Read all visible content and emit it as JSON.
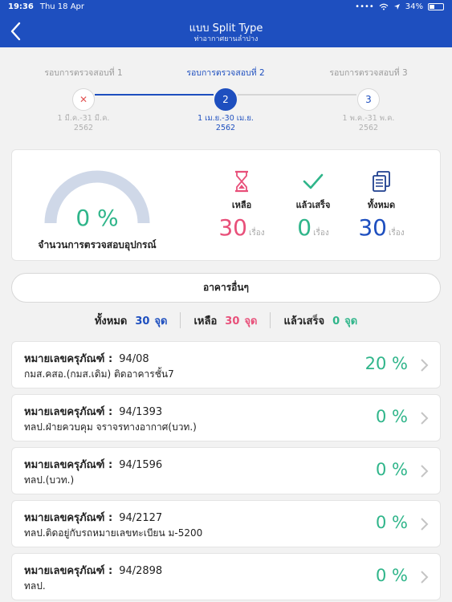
{
  "status_bar": {
    "time": "19:36",
    "date": "Thu 18 Apr",
    "battery": "34%"
  },
  "header": {
    "title": "แบบ Split Type",
    "subtitle": "ท่าอากาศยานลำปาง"
  },
  "steps": [
    {
      "label": "รอบการตรวจสอบที่ 1",
      "marker": "✕",
      "date1": "1 มี.ค.-31 มี.ค.",
      "date2": "2562"
    },
    {
      "label": "รอบการตรวจสอบที่ 2",
      "marker": "2",
      "date1": "1 เม.ย.-30 เม.ย.",
      "date2": "2562"
    },
    {
      "label": "รอบการตรวจสอบที่ 3",
      "marker": "3",
      "date1": "1 พ.ค.-31 พ.ค.",
      "date2": "2562"
    }
  ],
  "summary": {
    "gauge_value": "0 %",
    "gauge_label": "จำนวนการตรวจสอบอุปกรณ์",
    "stats": [
      {
        "name": "เหลือ",
        "value": "30",
        "unit": "เรื่อง",
        "color": "#e8507a",
        "icon": "hourglass-icon"
      },
      {
        "name": "แล้วเสร็จ",
        "value": "0",
        "unit": "เรื่อง",
        "color": "#2fb58a",
        "icon": "check-icon"
      },
      {
        "name": "ทั้งหมด",
        "value": "30",
        "unit": "เรื่อง",
        "color": "#1e4fbf",
        "icon": "documents-icon"
      }
    ]
  },
  "building": {
    "label": "อาคารอื่นๆ"
  },
  "counts": [
    {
      "label": "ทั้งหมด",
      "value": "30",
      "unit": "จุด",
      "color": "#1e4fbf"
    },
    {
      "label": "เหลือ",
      "value": "30",
      "unit": "จุด",
      "color": "#e8507a"
    },
    {
      "label": "แล้วเสร็จ",
      "value": "0",
      "unit": "จุด",
      "color": "#2fb58a"
    }
  ],
  "devices": [
    {
      "key": "หมายเลขครุภัณฑ์ :",
      "id": "94/08",
      "desc": "กมส.คสอ.(กมส.เดิม) ติดอาคารชั้น7",
      "percent": "20 %"
    },
    {
      "key": "หมายเลขครุภัณฑ์ :",
      "id": "94/1393",
      "desc": "ทลป.ฝ่ายควบคุม จราจรทางอากาศ(บวท.)",
      "percent": "0 %"
    },
    {
      "key": "หมายเลขครุภัณฑ์ :",
      "id": "94/1596",
      "desc": "ทลป.(บวท.)",
      "percent": "0 %"
    },
    {
      "key": "หมายเลขครุภัณฑ์ :",
      "id": "94/2127",
      "desc": "ทลป.ติดอยู่กับรถหมายเลขทะเบียน ม-5200",
      "percent": "0 %"
    },
    {
      "key": "หมายเลขครุภัณฑ์ :",
      "id": "94/2898",
      "desc": "ทลป.",
      "percent": "0 %"
    }
  ]
}
